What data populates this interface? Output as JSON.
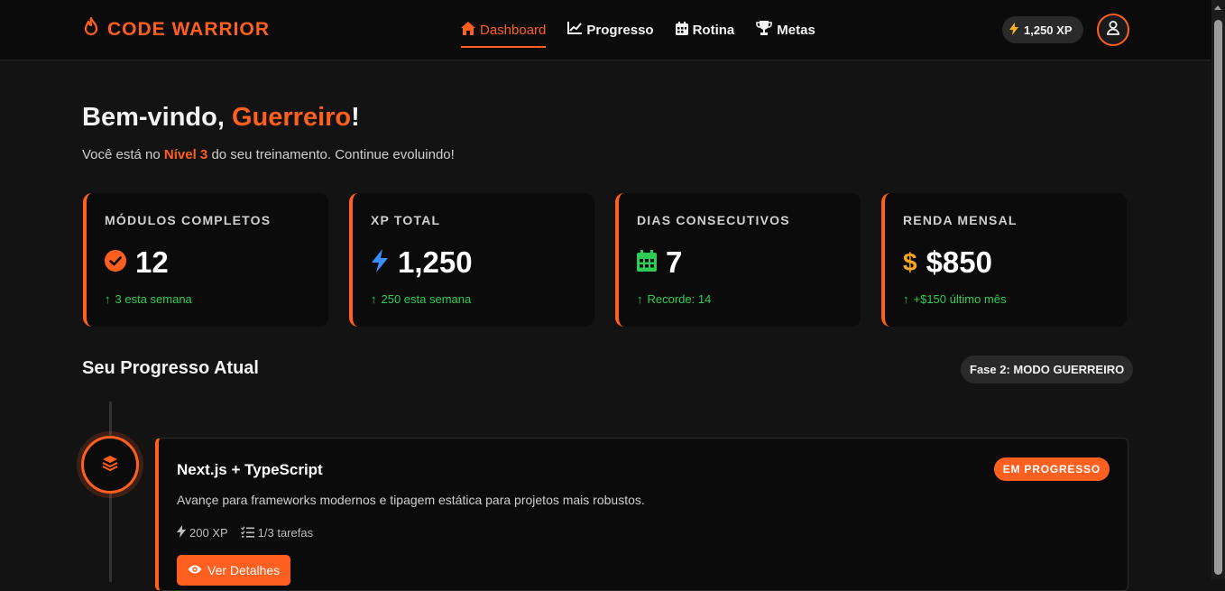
{
  "header": {
    "brand": "CODE WARRIOR",
    "nav": [
      {
        "label": "Dashboard",
        "icon": "home-icon",
        "active": true
      },
      {
        "label": "Progresso",
        "icon": "chart-line-icon"
      },
      {
        "label": "Rotina",
        "icon": "calendar-icon"
      },
      {
        "label": "Metas",
        "icon": "trophy-icon"
      }
    ],
    "xp": "1,250 XP"
  },
  "welcome": {
    "greeting": "Bem-vindo, ",
    "name": "Guerreiro",
    "exclaim": "!",
    "sub_before": "Você está no ",
    "level": "Nível 3",
    "sub_after": " do seu treinamento. Continue evoluindo!"
  },
  "stats": [
    {
      "label": "MÓDULOS COMPLETOS",
      "value": "12",
      "trend": "3 esta semana",
      "icon": "check-circle-icon",
      "icon_color": "#ff5f1f"
    },
    {
      "label": "XP TOTAL",
      "value": "1,250",
      "trend": "250 esta semana",
      "icon": "bolt-icon",
      "icon_color": "#3a8dff"
    },
    {
      "label": "DIAS CONSECUTIVOS",
      "value": "7",
      "trend": "Recorde: 14",
      "icon": "calendar-icon",
      "icon_color": "#2ecc55"
    },
    {
      "label": "RENDA MENSAL",
      "value": "$850",
      "trend": "+$150 último mês",
      "icon": "dollar-icon",
      "icon_color": "#f5a623"
    }
  ],
  "progress": {
    "title": "Seu Progresso Atual",
    "phase": "Fase 2: MODO GUERREIRO",
    "module": {
      "title": "Next.js + TypeScript",
      "status": "EM PROGRESSO",
      "description": "Avançe para frameworks modernos e tipagem estática para projetos mais robustos.",
      "xp": "200 XP",
      "tasks": "1/3 tarefas",
      "button": "Ver Detalhes"
    }
  },
  "colors": {
    "accent": "#ff5f1f",
    "positive": "#2ecc55",
    "background": "#131313"
  }
}
